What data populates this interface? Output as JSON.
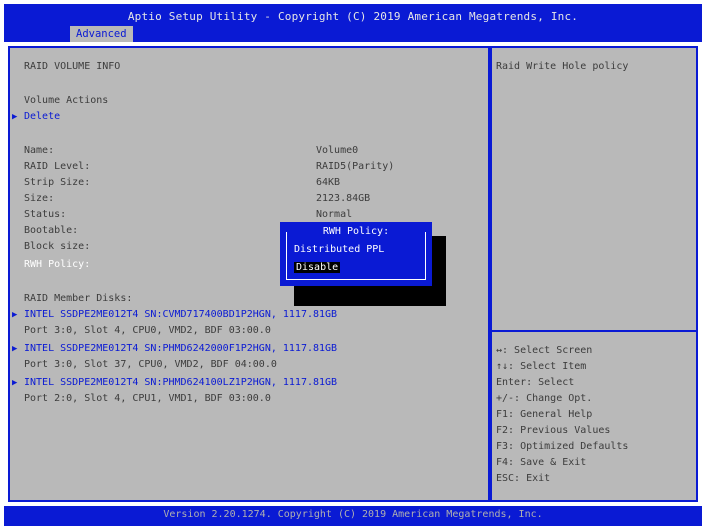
{
  "header": {
    "title": "Aptio Setup Utility - Copyright (C) 2019 American Megatrends, Inc.",
    "active_tab": "Advanced"
  },
  "main": {
    "section_title": "RAID VOLUME INFO",
    "volume_actions_label": "Volume Actions",
    "delete_label": "Delete",
    "fields": [
      {
        "label": "Name:",
        "value": "Volume0"
      },
      {
        "label": "RAID Level:",
        "value": "RAID5(Parity)"
      },
      {
        "label": "Strip Size:",
        "value": "64KB"
      },
      {
        "label": "Size:",
        "value": "2123.84GB"
      },
      {
        "label": "Status:",
        "value": "Normal"
      },
      {
        "label": "Bootable:",
        "value": ""
      },
      {
        "label": "Block size:",
        "value": ""
      }
    ],
    "rwh_policy_label": "RWH Policy:",
    "member_disks_label": "RAID Member Disks:",
    "disks": [
      {
        "title": "INTEL SSDPE2ME012T4 SN:CVMD717400BD1P2HGN, 1117.81GB",
        "location": "Port  3:0, Slot   4, CPU0, VMD2, BDF 03:00.0"
      },
      {
        "title": "INTEL SSDPE2ME012T4 SN:PHMD6242000F1P2HGN, 1117.81GB",
        "location": "Port  3:0, Slot  37, CPU0, VMD2, BDF 04:00.0"
      },
      {
        "title": "INTEL SSDPE2ME012T4 SN:PHMD624100LZ1P2HGN, 1117.81GB",
        "location": "Port  2:0, Slot   4, CPU1, VMD1, BDF 03:00.0"
      }
    ]
  },
  "popup": {
    "title": "RWH Policy:",
    "options": [
      "Distributed PPL",
      "Disable"
    ],
    "selected_index": 1
  },
  "help": {
    "description": "Raid Write Hole policy",
    "keys": [
      "↔: Select Screen",
      "↑↓: Select Item",
      "Enter: Select",
      "+/-: Change Opt.",
      "F1: General Help",
      "F2: Previous Values",
      "F3: Optimized Defaults",
      "F4: Save & Exit",
      "ESC: Exit"
    ]
  },
  "footer": {
    "text": "Version 2.20.1274. Copyright (C) 2019 American Megatrends, Inc."
  },
  "colors": {
    "bios_blue": "#0a1ad4",
    "panel_gray": "#b9b9b9",
    "highlight_white": "#ffffff"
  }
}
